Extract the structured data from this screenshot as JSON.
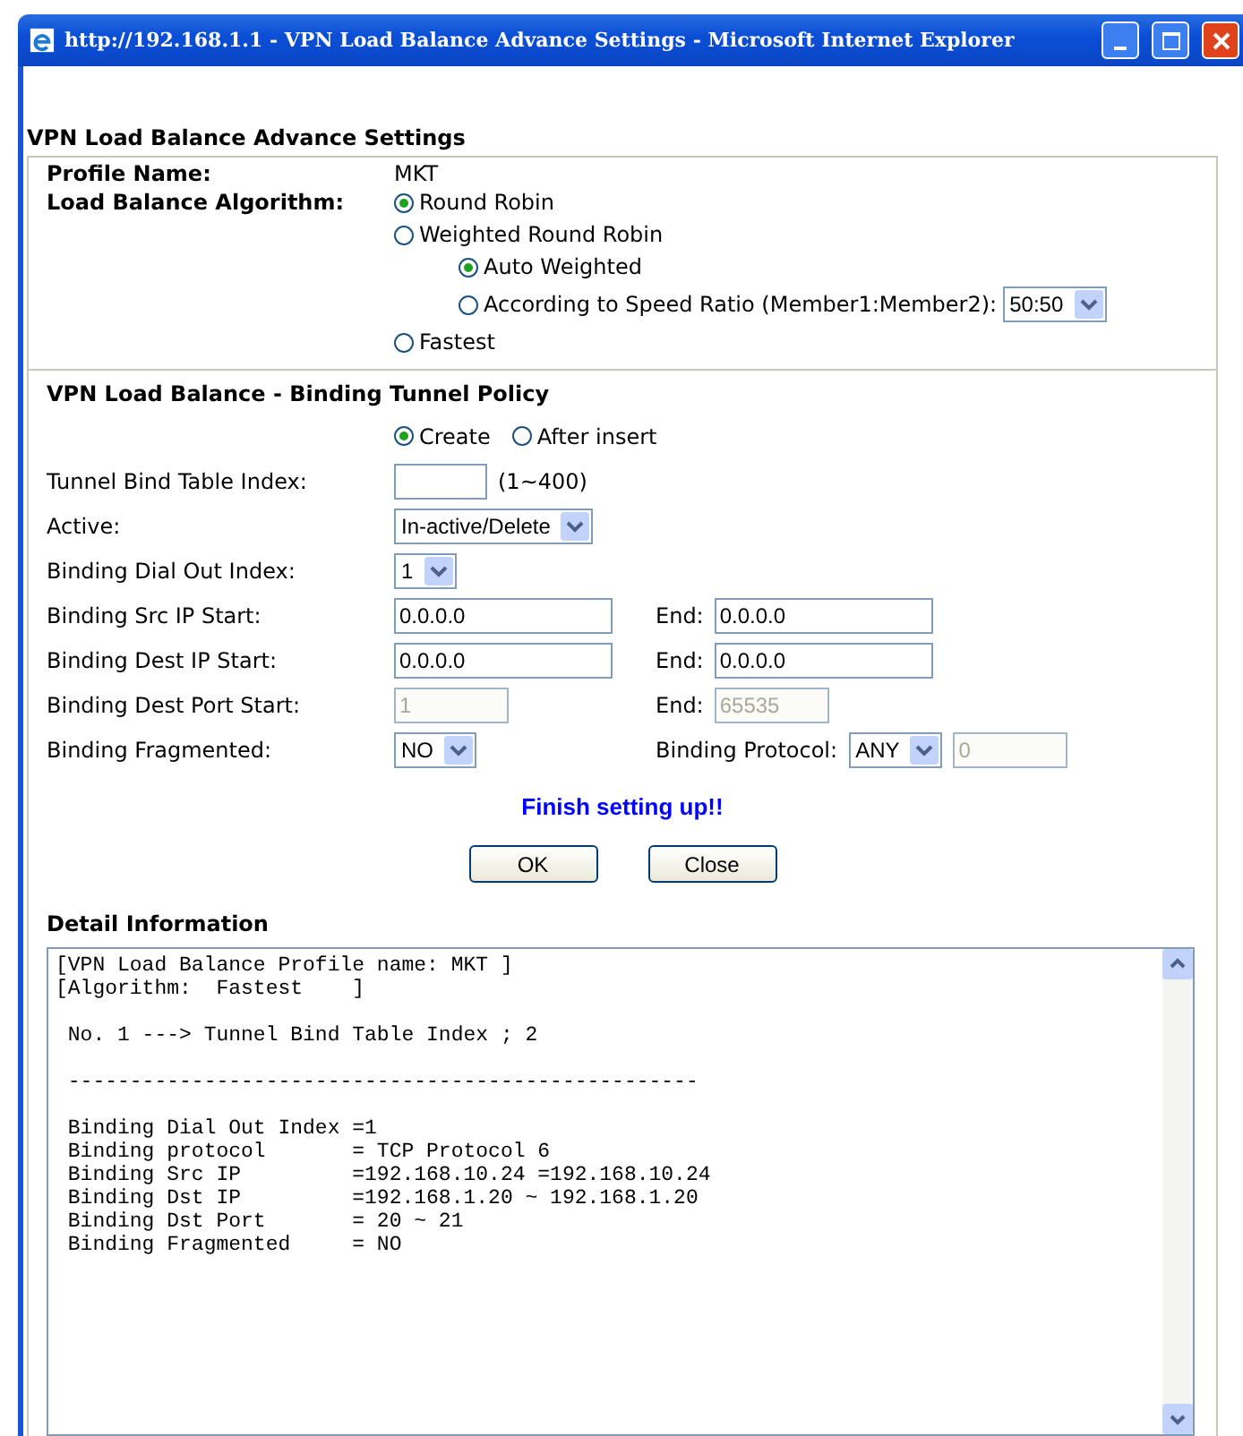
{
  "window": {
    "title": "http://192.168.1.1 - VPN Load Balance Advance Settings - Microsoft Internet Explorer"
  },
  "heading": "VPN Load Balance Advance Settings",
  "profile": {
    "label": "Profile Name:",
    "value": "MKT"
  },
  "algorithm": {
    "label": "Load Balance Algorithm:",
    "options": [
      {
        "label": "Round Robin",
        "selected": true
      },
      {
        "label": "Weighted Round Robin",
        "selected": false,
        "children": [
          {
            "label": "Auto Weighted",
            "selected": true
          },
          {
            "label": "According to Speed Ratio (Member1:Member2):",
            "selected": false,
            "select": "50:50"
          }
        ]
      },
      {
        "label": "Fastest",
        "selected": false
      }
    ]
  },
  "binding": {
    "title": "VPN Load Balance - Binding Tunnel Policy",
    "modes": [
      {
        "label": "Create",
        "selected": true
      },
      {
        "label": "After insert",
        "selected": false
      }
    ],
    "rows": [
      {
        "label": "Tunnel Bind Table Index:",
        "start": [
          {
            "kind": "index",
            "disabled": false
          },
          {
            "kind": "note",
            "value": "(1~400)"
          }
        ]
      },
      {
        "label": "Active:",
        "start": [
          {
            "kind": "select",
            "value": "In-active/Delete"
          }
        ]
      },
      {
        "label": "Binding Dial Out Index:",
        "start": [
          {
            "kind": "select",
            "value": "1"
          }
        ]
      },
      {
        "label": "Binding Src IP Start:",
        "start": [
          {
            "kind": "ip",
            "value": "0.0.0.0",
            "disabled": false
          }
        ],
        "end_label": "End:",
        "end": [
          {
            "kind": "ip",
            "value": "0.0.0.0",
            "disabled": false
          }
        ]
      },
      {
        "label": "Binding Dest IP Start:",
        "start": [
          {
            "kind": "ip",
            "value": "0.0.0.0",
            "disabled": false
          }
        ],
        "end_label": "End:",
        "end": [
          {
            "kind": "ip",
            "value": "0.0.0.0",
            "disabled": false
          }
        ]
      },
      {
        "label": "Binding Dest Port Start:",
        "start": [
          {
            "kind": "port",
            "value": "1",
            "disabled": true
          }
        ],
        "end_label": "End:",
        "end": [
          {
            "kind": "port",
            "value": "65535",
            "disabled": true
          }
        ]
      },
      {
        "label": "Binding Fragmented:",
        "start": [
          {
            "kind": "select",
            "value": "NO"
          }
        ],
        "end_label": "Binding Protocol:",
        "end": [
          {
            "kind": "select",
            "value": "ANY"
          },
          {
            "kind": "port",
            "value": "0",
            "disabled": true
          }
        ]
      }
    ],
    "message": "Finish setting up!!",
    "buttons": [
      "OK",
      "Close"
    ]
  },
  "detail": {
    "title": "Detail Information",
    "text": "[VPN Load Balance Profile name: MKT ]\n[Algorithm:  Fastest    ]\n\n No. 1 ---> Tunnel Bind Table Index ; 2\n\n ---------------------------------------------------\n\n Binding Dial Out Index =1\n Binding protocol       = TCP Protocol 6\n Binding Src IP         =192.168.10.24 =192.168.10.24\n Binding Dst IP         =192.168.1.20 ~ 192.168.1.20\n Binding Dst Port       = 20 ~ 21\n Binding Fragmented     = NO"
  }
}
